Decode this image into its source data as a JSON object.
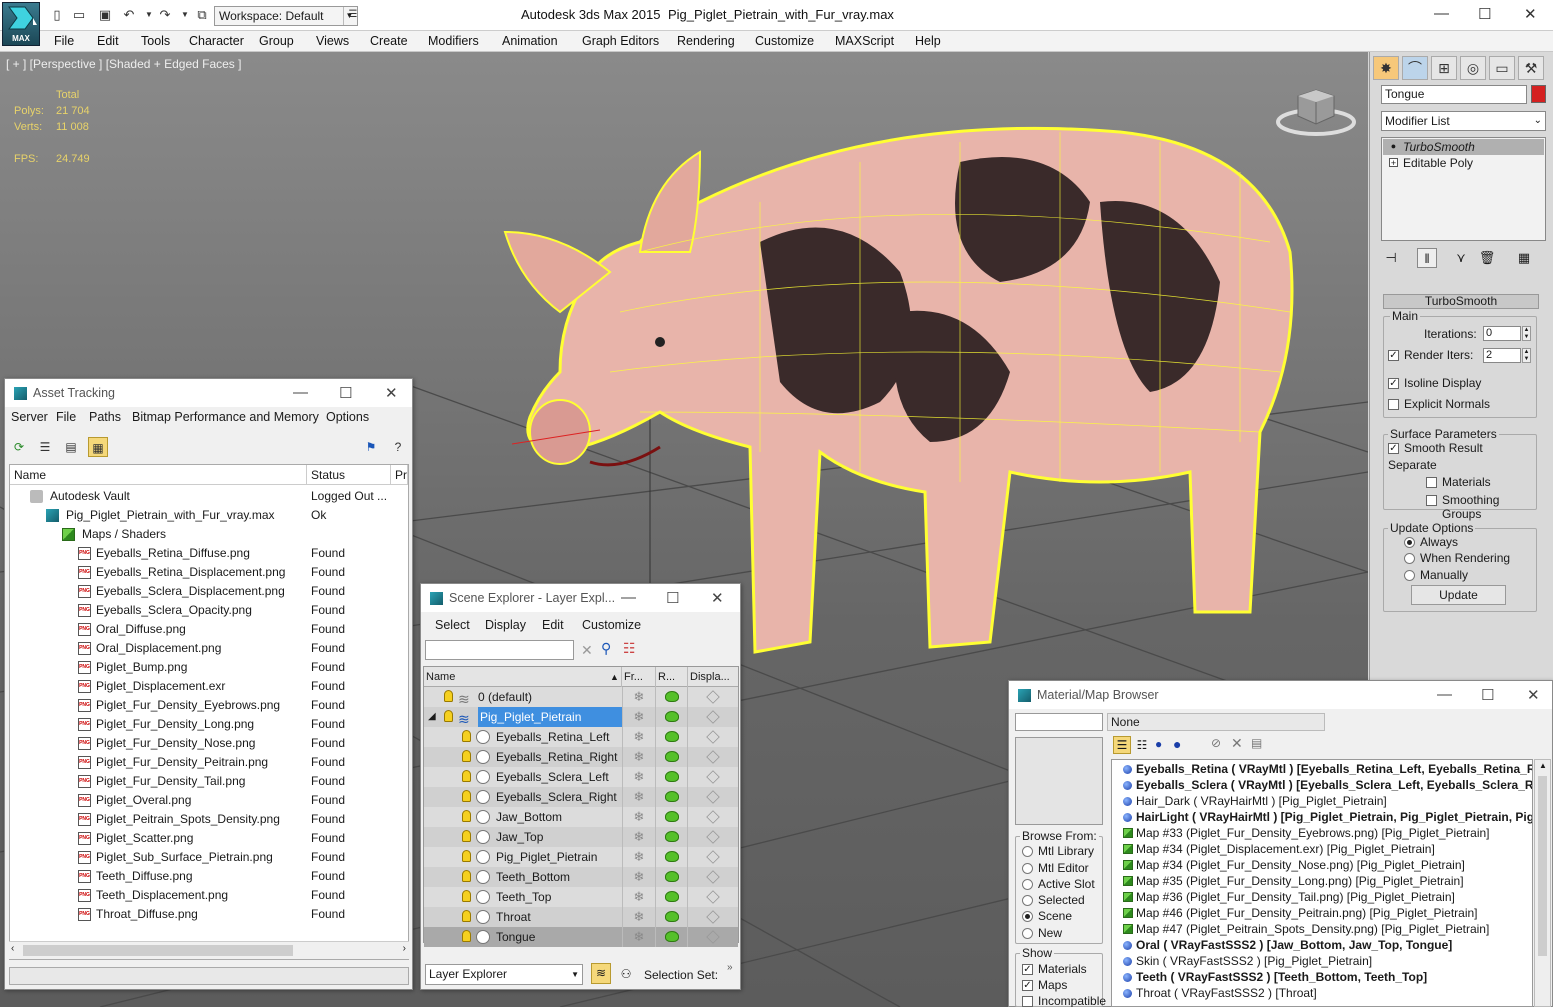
{
  "titlebar": {
    "logo_text": "MAX",
    "workspace": "Workspace: Default",
    "app_title": "Autodesk 3ds Max  2015",
    "file_title": "Pig_Piglet_Pietrain_with_Fur_vray.max"
  },
  "menu": [
    "File",
    "Edit",
    "Tools",
    "Character",
    "Group",
    "Views",
    "Create",
    "Modifiers",
    "Animation",
    "Graph Editors",
    "Rendering",
    "Customize",
    "MAXScript",
    "Help"
  ],
  "viewport": {
    "label": "[ + ] [Perspective ] [Shaded + Edged Faces ]",
    "stats": {
      "total_label": "Total",
      "polys_label": "Polys:",
      "polys": "21 704",
      "verts_label": "Verts:",
      "verts": "11 008",
      "fps_label": "FPS:",
      "fps": "24.749"
    }
  },
  "command_panel": {
    "object_name": "Tongue",
    "object_color": "#d42020",
    "modifier_list": "Modifier List",
    "stack": [
      "TurboSmooth",
      "Editable Poly"
    ],
    "rollout": "TurboSmooth",
    "main_group": "Main",
    "iterations_label": "Iterations:",
    "iterations": "0",
    "render_iters_label": "Render Iters:",
    "render_iters": "2",
    "isoline_label": "Isoline Display",
    "explicit_label": "Explicit Normals",
    "surface_group": "Surface Parameters",
    "smooth_label": "Smooth Result",
    "separate_label": "Separate",
    "materials_label": "Materials",
    "smoothing_label": "Smoothing Groups",
    "update_group": "Update Options",
    "always": "Always",
    "when_rendering": "When Rendering",
    "manually": "Manually",
    "update_btn": "Update"
  },
  "asset_tracking": {
    "title": "Asset Tracking",
    "menu": [
      "Server",
      "File",
      "Paths",
      "Bitmap Performance and Memory",
      "Options"
    ],
    "columns": [
      "Name",
      "Status",
      "Pr"
    ],
    "rows": [
      {
        "name": "Autodesk Vault",
        "status": "Logged Out ..."
      },
      {
        "name": "Pig_Piglet_Pietrain_with_Fur_vray.max",
        "status": "Ok"
      },
      {
        "name": "Maps / Shaders",
        "status": ""
      },
      {
        "name": "Eyeballs_Retina_Diffuse.png",
        "status": "Found"
      },
      {
        "name": "Eyeballs_Retina_Displacement.png",
        "status": "Found"
      },
      {
        "name": "Eyeballs_Sclera_Displacement.png",
        "status": "Found"
      },
      {
        "name": "Eyeballs_Sclera_Opacity.png",
        "status": "Found"
      },
      {
        "name": "Oral_Diffuse.png",
        "status": "Found"
      },
      {
        "name": "Oral_Displacement.png",
        "status": "Found"
      },
      {
        "name": "Piglet_Bump.png",
        "status": "Found"
      },
      {
        "name": "Piglet_Displacement.exr",
        "status": "Found"
      },
      {
        "name": "Piglet_Fur_Density_Eyebrows.png",
        "status": "Found"
      },
      {
        "name": "Piglet_Fur_Density_Long.png",
        "status": "Found"
      },
      {
        "name": "Piglet_Fur_Density_Nose.png",
        "status": "Found"
      },
      {
        "name": "Piglet_Fur_Density_Peitrain.png",
        "status": "Found"
      },
      {
        "name": "Piglet_Fur_Density_Tail.png",
        "status": "Found"
      },
      {
        "name": "Piglet_Overal.png",
        "status": "Found"
      },
      {
        "name": "Piglet_Peitrain_Spots_Density.png",
        "status": "Found"
      },
      {
        "name": "Piglet_Scatter.png",
        "status": "Found"
      },
      {
        "name": "Piglet_Sub_Surface_Pietrain.png",
        "status": "Found"
      },
      {
        "name": "Teeth_Diffuse.png",
        "status": "Found"
      },
      {
        "name": "Teeth_Displacement.png",
        "status": "Found"
      },
      {
        "name": "Throat_Diffuse.png",
        "status": "Found"
      }
    ]
  },
  "scene_explorer": {
    "title": "Scene Explorer - Layer Expl...",
    "menu": [
      "Select",
      "Display",
      "Edit",
      "Customize"
    ],
    "columns": [
      "Name",
      "Fr...",
      "R...",
      "Displa..."
    ],
    "rows": [
      "0 (default)",
      "Pig_Piglet_Pietrain",
      "Eyeballs_Retina_Left",
      "Eyeballs_Retina_Right",
      "Eyeballs_Sclera_Left",
      "Eyeballs_Sclera_Right",
      "Jaw_Bottom",
      "Jaw_Top",
      "Pig_Piglet_Pietrain",
      "Teeth_Bottom",
      "Teeth_Top",
      "Throat",
      "Tongue"
    ],
    "layer_explorer": "Layer Explorer",
    "selection_set": "Selection Set:"
  },
  "material_browser": {
    "title": "Material/Map Browser",
    "none": "None",
    "browse_from": "Browse From:",
    "browse_options": [
      "Mtl Library",
      "Mtl Editor",
      "Active Slot",
      "Selected",
      "Scene",
      "New"
    ],
    "show": "Show",
    "show_options": [
      "Materials",
      "Maps",
      "Incompatible"
    ],
    "items": [
      {
        "kind": "mtl",
        "bold": true,
        "text": "Eyeballs_Retina  ( VRayMtl )  [Eyeballs_Retina_Left, Eyeballs_Retina_R"
      },
      {
        "kind": "mtl",
        "bold": true,
        "text": "Eyeballs_Sclera  ( VRayMtl )  [Eyeballs_Sclera_Left, Eyeballs_Sclera_Ri"
      },
      {
        "kind": "mtl",
        "bold": false,
        "text": "Hair_Dark  ( VRayHairMtl )  [Pig_Piglet_Pietrain]"
      },
      {
        "kind": "mtl",
        "bold": true,
        "text": "HairLight  ( VRayHairMtl )  [Pig_Piglet_Pietrain, Pig_Piglet_Pietrain, Pig"
      },
      {
        "kind": "map",
        "bold": false,
        "text": "Map #33 (Piglet_Fur_Density_Eyebrows.png)  [Pig_Piglet_Pietrain]"
      },
      {
        "kind": "map",
        "bold": false,
        "text": "Map #34 (Piglet_Displacement.exr)  [Pig_Piglet_Pietrain]"
      },
      {
        "kind": "map",
        "bold": false,
        "text": "Map #34 (Piglet_Fur_Density_Nose.png)  [Pig_Piglet_Pietrain]"
      },
      {
        "kind": "map",
        "bold": false,
        "text": "Map #35 (Piglet_Fur_Density_Long.png)  [Pig_Piglet_Pietrain]"
      },
      {
        "kind": "map",
        "bold": false,
        "text": "Map #36 (Piglet_Fur_Density_Tail.png)  [Pig_Piglet_Pietrain]"
      },
      {
        "kind": "map",
        "bold": false,
        "text": "Map #46 (Piglet_Fur_Density_Peitrain.png)  [Pig_Piglet_Pietrain]"
      },
      {
        "kind": "map",
        "bold": false,
        "text": "Map #47 (Piglet_Peitrain_Spots_Density.png)  [Pig_Piglet_Pietrain]"
      },
      {
        "kind": "mtl",
        "bold": true,
        "text": "Oral  ( VRayFastSSS2 )  [Jaw_Bottom, Jaw_Top, Tongue]"
      },
      {
        "kind": "mtl",
        "bold": false,
        "text": "Skin  ( VRayFastSSS2 )  [Pig_Piglet_Pietrain]"
      },
      {
        "kind": "mtl",
        "bold": true,
        "text": "Teeth  ( VRayFastSSS2 )  [Teeth_Bottom, Teeth_Top]"
      },
      {
        "kind": "mtl",
        "bold": false,
        "text": "Throat  ( VRayFastSSS2 )  [Throat]"
      }
    ]
  }
}
